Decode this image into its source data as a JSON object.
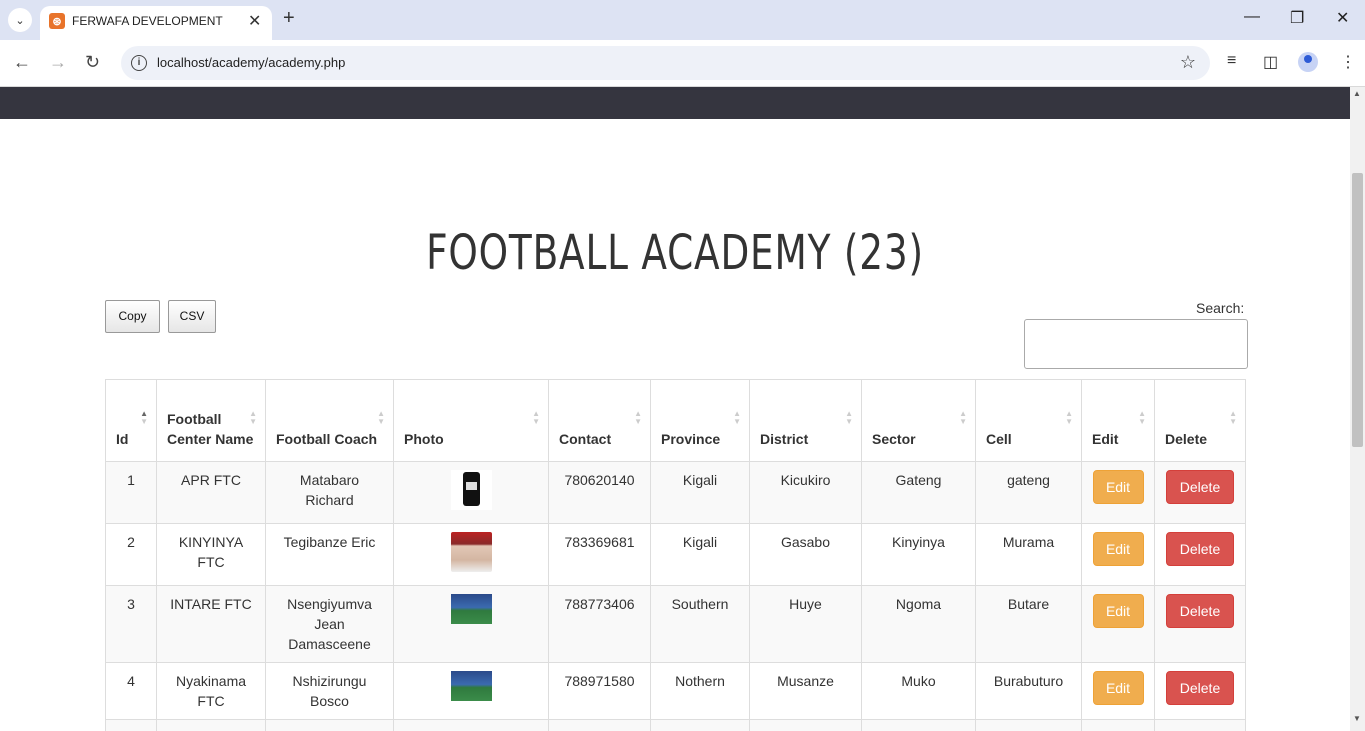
{
  "browser": {
    "tab_title": "FERWAFA DEVELOPMENT",
    "url": "localhost/academy/academy.php"
  },
  "page": {
    "title": "FOOTBALL ACADEMY (23)",
    "copy_label": "Copy",
    "csv_label": "CSV",
    "search_label": "Search:"
  },
  "table": {
    "headers": [
      "Id",
      "Football Center Name",
      "Football Coach",
      "Photo",
      "Contact",
      "Province",
      "District",
      "Sector",
      "Cell",
      "Edit",
      "Delete"
    ],
    "rows": [
      {
        "id": "1",
        "center": "APR FTC",
        "coach": "Matabaro Richard",
        "photo": "phone-photo",
        "contact": "780620140",
        "province": "Kigali",
        "district": "Kicukiro",
        "sector": "Gateng",
        "cell": "gateng",
        "edit": "Edit",
        "delete": "Delete"
      },
      {
        "id": "2",
        "center": "KINYINYA FTC",
        "coach": "Tegibanze Eric",
        "photo": "coach-photo",
        "contact": "783369681",
        "province": "Kigali",
        "district": "Gasabo",
        "sector": "Kinyinya",
        "cell": "Murama",
        "edit": "Edit",
        "delete": "Delete"
      },
      {
        "id": "3",
        "center": "INTARE FTC",
        "coach": "Nsengiyumva Jean Damasceene",
        "photo": "field-photo",
        "contact": "788773406",
        "province": "Southern",
        "district": "Huye",
        "sector": "Ngoma",
        "cell": "Butare",
        "edit": "Edit",
        "delete": "Delete"
      },
      {
        "id": "4",
        "center": "Nyakinama FTC",
        "coach": "Nshizirungu Bosco",
        "photo": "field-photo",
        "contact": "788971580",
        "province": "Nothern",
        "district": "Musanze",
        "sector": "Muko",
        "cell": "Burabuturo",
        "edit": "Edit",
        "delete": "Delete"
      }
    ]
  }
}
